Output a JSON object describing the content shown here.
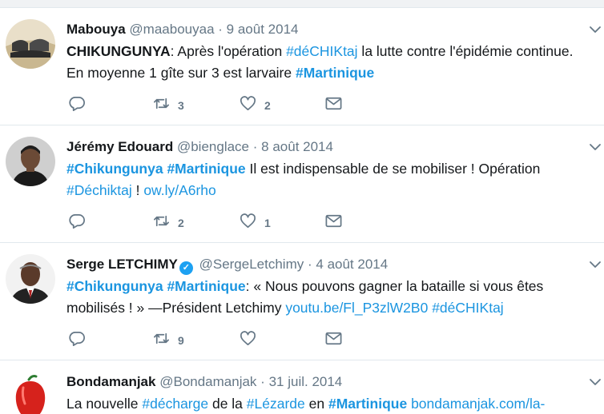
{
  "tweets": [
    {
      "name": "Mabouya",
      "handle": "@maabouyaa",
      "separator": "·",
      "date": "9 août 2014",
      "text": [
        {
          "t": "CHIKUNGUNYA",
          "s": "bold"
        },
        {
          "t": ": Après l'opération ",
          "s": "plain"
        },
        {
          "t": "#déCHIKtaj",
          "s": "link"
        },
        {
          "t": " la lutte contre l'épidémie continue. En moyenne 1 gîte sur 3 est larvaire ",
          "s": "plain"
        },
        {
          "t": "#Martinique",
          "s": "tag"
        }
      ],
      "reply_count": "",
      "retweet_count": "3",
      "like_count": "2"
    },
    {
      "name": "Jérémy Edouard",
      "handle": "@bienglace",
      "separator": "·",
      "date": "8 août 2014",
      "text": [
        {
          "t": "#Chikungunya",
          "s": "tag"
        },
        {
          "t": " ",
          "s": "plain"
        },
        {
          "t": "#Martinique",
          "s": "tag"
        },
        {
          "t": " Il est indispensable de se mobiliser ! Opération ",
          "s": "plain"
        },
        {
          "t": "#Déchiktaj",
          "s": "link"
        },
        {
          "t": " ! ",
          "s": "plain"
        },
        {
          "t": "ow.ly/A6rho",
          "s": "link"
        }
      ],
      "reply_count": "",
      "retweet_count": "2",
      "like_count": "1"
    },
    {
      "name": "Serge LETCHIMY",
      "verified_mark": "✓",
      "handle": "@SergeLetchimy",
      "separator": "·",
      "date": "4 août 2014",
      "text": [
        {
          "t": "#Chikungunya",
          "s": "tag"
        },
        {
          "t": " ",
          "s": "plain"
        },
        {
          "t": "#Martinique",
          "s": "tag"
        },
        {
          "t": ": « Nous pouvons gagner la bataille si vous êtes mobilisés ! » —Président Letchimy ",
          "s": "plain"
        },
        {
          "t": "youtu.be/Fl_P3zlW2B0",
          "s": "link"
        },
        {
          "t": " ",
          "s": "plain"
        },
        {
          "t": "#déCHIKtaj",
          "s": "link"
        }
      ],
      "reply_count": "",
      "retweet_count": "9",
      "like_count": ""
    },
    {
      "name": "Bondamanjak",
      "handle": "@Bondamanjak",
      "separator": "·",
      "date": "31 juil. 2014",
      "text": [
        {
          "t": "La nouvelle ",
          "s": "plain"
        },
        {
          "t": "#décharge",
          "s": "link"
        },
        {
          "t": " de la ",
          "s": "plain"
        },
        {
          "t": "#Lézarde",
          "s": "link"
        },
        {
          "t": " en ",
          "s": "plain"
        },
        {
          "t": "#Martinique",
          "s": "tag"
        },
        {
          "t": "  ",
          "s": "plain"
        },
        {
          "t": "bondamanjak.com/la-",
          "s": "link"
        }
      ]
    }
  ],
  "icons": {
    "reply": "reply-icon",
    "retweet": "retweet-icon",
    "like": "heart-icon",
    "dm": "envelope-icon",
    "menu": "chevron-down-icon"
  },
  "colors": {
    "link": "#1b95e0",
    "text": "#14171a",
    "secondary": "#657786",
    "border": "#e1e8ed"
  }
}
